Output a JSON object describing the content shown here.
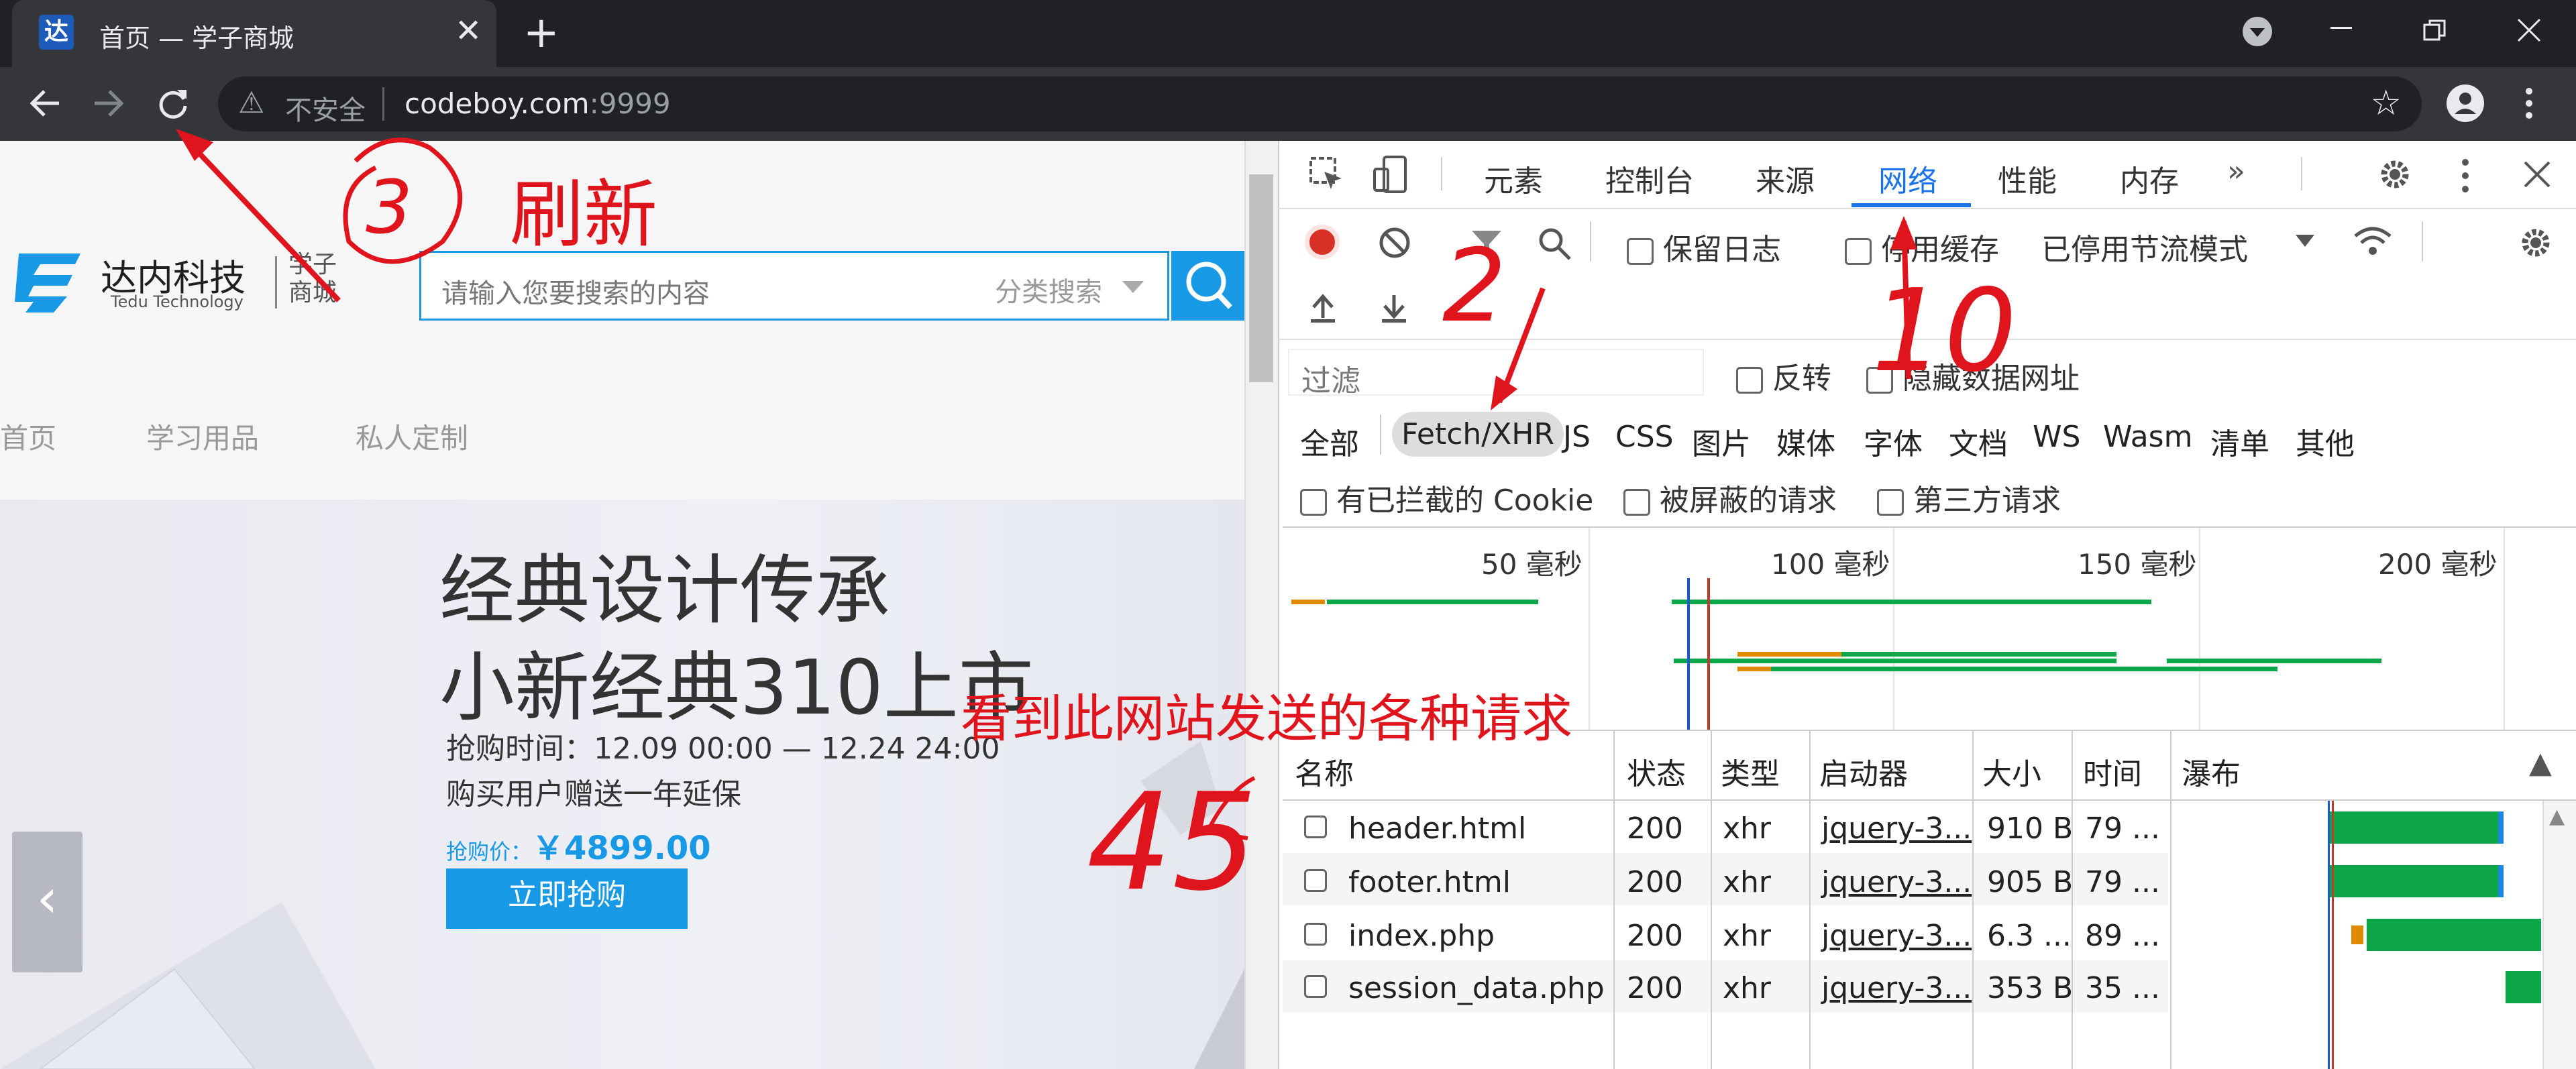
{
  "browser": {
    "tab_title": "首页 — 学子商城",
    "tab_favicon": "达",
    "new_tab_label": "+",
    "close_tab": "✕",
    "security_label": "不安全",
    "url_host": "codeboy.com",
    "url_port": ":9999"
  },
  "page": {
    "logo_name": "达内科技",
    "logo_en": "Tedu Technology",
    "logo_sub": "学子商城",
    "search_placeholder": "请输入您要搜索的内容",
    "search_category": "分类搜索",
    "nav": [
      "首页",
      "学习用品",
      "私人定制"
    ],
    "banner": {
      "title1": "经典设计传承",
      "title2": "小新经典310上市",
      "time": "抢购时间：12.09 00:00 — 12.24 24:00",
      "gift": "购买用户赠送一年延保",
      "price_label": "抢购价：",
      "price_value": "￥4899.00",
      "buy_label": "立即抢购"
    }
  },
  "devtools": {
    "tabs": [
      "元素",
      "控制台",
      "来源",
      "网络",
      "性能",
      "内存"
    ],
    "active_tab": "网络",
    "more_tabs": "»",
    "preserve_log": "保留日志",
    "disable_cache": "停用缓存",
    "throttle": "已停用节流模式",
    "filter_placeholder": "过滤",
    "invert": "反转",
    "hide_data_urls": "隐藏数据网址",
    "types": [
      "全部",
      "Fetch/XHR",
      "JS",
      "CSS",
      "图片",
      "媒体",
      "字体",
      "文档",
      "WS",
      "Wasm",
      "清单",
      "其他"
    ],
    "blocked_cookies": "有已拦截的 Cookie",
    "blocked_requests": "被屏蔽的请求",
    "third_party": "第三方请求",
    "timeline_ticks": [
      "50 毫秒",
      "100 毫秒",
      "150 毫秒",
      "200 毫秒"
    ],
    "columns": [
      "名称",
      "状态",
      "类型",
      "启动器",
      "大小",
      "时间",
      "瀑布"
    ],
    "rows": [
      {
        "name": "header.html",
        "status": "200",
        "type": "xhr",
        "initiator": "jquery-3...",
        "size": "910 B",
        "time": "79 ..."
      },
      {
        "name": "footer.html",
        "status": "200",
        "type": "xhr",
        "initiator": "jquery-3...",
        "size": "905 B",
        "time": "79 ..."
      },
      {
        "name": "index.php",
        "status": "200",
        "type": "xhr",
        "initiator": "jquery-3...",
        "size": "6.3 ...",
        "time": "89 ..."
      },
      {
        "name": "session_data.php",
        "status": "200",
        "type": "xhr",
        "initiator": "jquery-3...",
        "size": "353 B",
        "time": "35 ..."
      }
    ]
  },
  "annotations": {
    "refresh_label": "刷新",
    "num3": "3",
    "num2": "2",
    "num10": "10",
    "num45": "45",
    "requests_note": "看到此网站发送的各种请求"
  },
  "colors": {
    "accent": "#1a73e8",
    "brand": "#1899e6",
    "annotation": "#e0141c",
    "waterfall_green": "#0da74a",
    "waterfall_orange": "#e08a00"
  }
}
